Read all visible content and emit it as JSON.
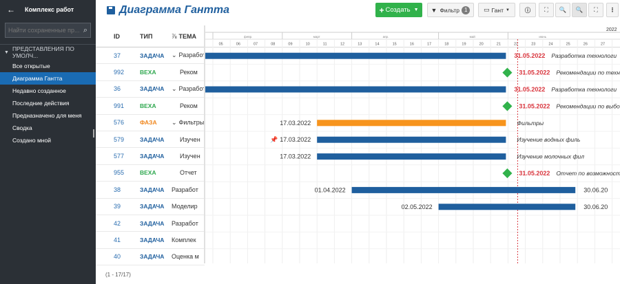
{
  "sidebar": {
    "title": "Комплекс работ",
    "search_placeholder": "Найти сохраненные пр...",
    "section_label": "ПРЕДСТАВЛЕНИЯ ПО УМОЛЧ...",
    "items": [
      {
        "label": "Все открытые",
        "active": false
      },
      {
        "label": "Диаграмма Гантта",
        "active": true
      },
      {
        "label": "Недавно созданное",
        "active": false
      },
      {
        "label": "Последние действия",
        "active": false
      },
      {
        "label": "Предназначено для меня",
        "active": false
      },
      {
        "label": "Сводка",
        "active": false
      },
      {
        "label": "Создано мной",
        "active": false
      }
    ]
  },
  "header": {
    "title": "Диаграмма Гантта",
    "create_label": "Создать",
    "filter_label": "Фильтр",
    "filter_count": "1",
    "gantt_label": "Гант"
  },
  "columns": {
    "id": "ID",
    "type": "ТИП",
    "topic": "ТЕМА"
  },
  "rows": [
    {
      "id": "37",
      "type": "ЗАДАЧА",
      "kind": "task",
      "topic": "Разработ",
      "indent": 0,
      "expand": true
    },
    {
      "id": "992",
      "type": "ВЕХА",
      "kind": "milestone",
      "topic": "Реком",
      "indent": 2,
      "expand": false
    },
    {
      "id": "36",
      "type": "ЗАДАЧА",
      "kind": "task",
      "topic": "Разработ",
      "indent": 0,
      "expand": true
    },
    {
      "id": "991",
      "type": "ВЕХА",
      "kind": "milestone",
      "topic": "Реком",
      "indent": 2,
      "expand": false
    },
    {
      "id": "576",
      "type": "ФАЗА",
      "kind": "phase",
      "topic": "Фильтры",
      "indent": 0,
      "expand": true
    },
    {
      "id": "579",
      "type": "ЗАДАЧА",
      "kind": "task",
      "topic": "Изучен",
      "indent": 2,
      "expand": false
    },
    {
      "id": "577",
      "type": "ЗАДАЧА",
      "kind": "task",
      "topic": "Изучен",
      "indent": 2,
      "expand": false
    },
    {
      "id": "955",
      "type": "ВЕХА",
      "kind": "milestone",
      "topic": "Отчет",
      "indent": 2,
      "expand": false
    },
    {
      "id": "38",
      "type": "ЗАДАЧА",
      "kind": "task",
      "topic": "Разработ",
      "indent": 0,
      "expand": false
    },
    {
      "id": "39",
      "type": "ЗАДАЧА",
      "kind": "task",
      "topic": "Моделир",
      "indent": 0,
      "expand": false
    },
    {
      "id": "42",
      "type": "ЗАДАЧА",
      "kind": "task",
      "topic": "Разработ",
      "indent": 0,
      "expand": false
    },
    {
      "id": "41",
      "type": "ЗАДАЧА",
      "kind": "task",
      "topic": "Комплек",
      "indent": 0,
      "expand": false
    },
    {
      "id": "40",
      "type": "ЗАДАЧА",
      "kind": "task",
      "topic": "Оценка м",
      "indent": 0,
      "expand": false
    }
  ],
  "footer": "(1 - 17/17)",
  "timeline": {
    "year": "2022",
    "months": [
      "февр.",
      "март",
      "апр.",
      "май",
      "июнь"
    ],
    "weeks": [
      "05",
      "06",
      "07",
      "08",
      "09",
      "10",
      "11",
      "12",
      "13",
      "14",
      "15",
      "16",
      "17",
      "18",
      "19",
      "20",
      "21",
      "22",
      "23",
      "24",
      "25",
      "26",
      "27"
    ]
  },
  "bars": [
    {
      "row": 0,
      "type": "bar",
      "start_week": "04",
      "end_week": "22",
      "end_label": "31.05.2022",
      "text": "Разработка технологи"
    },
    {
      "row": 1,
      "type": "milestone",
      "at_week": "22",
      "end_label": "31.05.2022",
      "text": "Рекомендации по техн"
    },
    {
      "row": 2,
      "type": "bar",
      "start_week": "04",
      "end_week": "22",
      "end_label": "31.05.2022",
      "text": "Разработка технологи"
    },
    {
      "row": 3,
      "type": "milestone",
      "at_week": "22",
      "end_label": "31.05.2022",
      "text": "Рекомендации по выбо"
    },
    {
      "row": 4,
      "type": "phase",
      "start_label": "17.03.2022",
      "start_week": "11",
      "end_week": "22",
      "text": "Фильтры"
    },
    {
      "row": 5,
      "type": "bar",
      "start_label": "17.03.2022",
      "start_week": "11",
      "end_week": "22",
      "text": "Изучение водных филь",
      "pin": true
    },
    {
      "row": 6,
      "type": "bar",
      "start_label": "17.03.2022",
      "start_week": "11",
      "end_week": "22",
      "text": "Изучение молочных фил"
    },
    {
      "row": 7,
      "type": "milestone",
      "at_week": "22",
      "end_label": "31.05.2022",
      "text": "Отчет по возможности"
    },
    {
      "row": 8,
      "type": "bar",
      "start_label": "01.04.2022",
      "start_week": "13",
      "end_week": "26",
      "end_label": "30.06.20"
    },
    {
      "row": 9,
      "type": "bar",
      "start_label": "02.05.2022",
      "start_week": "18",
      "end_week": "26",
      "end_label": "30.06.20"
    }
  ],
  "colors": {
    "task_bar": "#1f5f9e",
    "phase_bar": "#f7941d",
    "milestone": "#31b24b",
    "today_line": "#d9363e",
    "accent": "#1a6bb3"
  }
}
